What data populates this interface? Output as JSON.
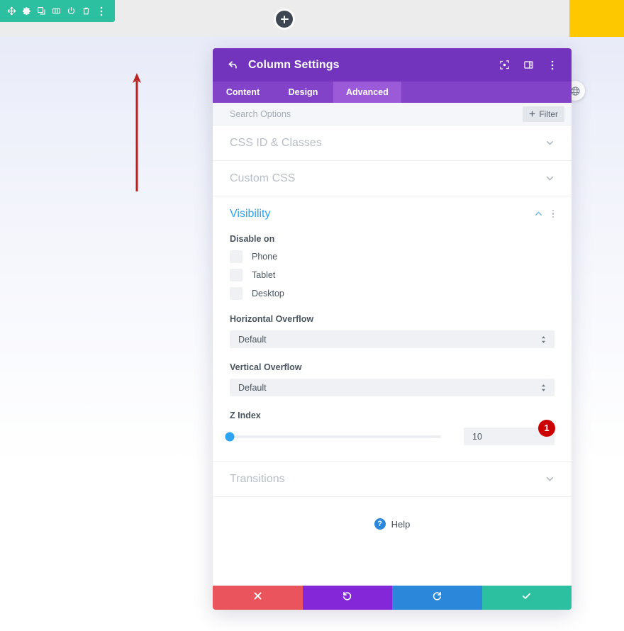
{
  "canvas": {
    "module_toolbar": {
      "buttons": [
        {
          "name": "move-icon",
          "label": "Move"
        },
        {
          "name": "gear-icon",
          "label": "Settings"
        },
        {
          "name": "duplicate-icon",
          "label": "Duplicate"
        },
        {
          "name": "columns-icon",
          "label": "Columns"
        },
        {
          "name": "power-icon",
          "label": "Disable"
        },
        {
          "name": "trash-icon",
          "label": "Delete"
        },
        {
          "name": "kebab-icon",
          "label": "More options"
        }
      ],
      "color": "#2cc0a0"
    },
    "add_button": {
      "name": "add-section-button",
      "label": "+"
    },
    "yellow_block": {
      "color": "#fdc800"
    },
    "globe_chip": {
      "name": "globe-icon"
    },
    "annotation_arrow": {
      "color": "#cc2222",
      "direction": "up"
    }
  },
  "modal": {
    "header": {
      "title": "Column Settings",
      "back_icon": "back-arrow-icon",
      "icons": [
        {
          "name": "focus-target-icon",
          "label": "Focus"
        },
        {
          "name": "layout-panel-icon",
          "label": "Panel layout"
        },
        {
          "name": "kebab-icon",
          "label": "More options"
        }
      ]
    },
    "tabs": [
      {
        "label": "Content",
        "active": false
      },
      {
        "label": "Design",
        "active": false
      },
      {
        "label": "Advanced",
        "active": true
      }
    ],
    "search": {
      "placeholder": "Search Options",
      "filter_label": "Filter",
      "filter_icon": "plus-icon"
    },
    "sections": [
      {
        "title": "CSS ID & Classes",
        "open": false
      },
      {
        "title": "Custom CSS",
        "open": false
      },
      {
        "title": "Visibility",
        "open": true
      },
      {
        "title": "Transitions",
        "open": false
      }
    ],
    "visibility": {
      "disable_on_label": "Disable on",
      "devices": [
        {
          "label": "Phone",
          "checked": false
        },
        {
          "label": "Tablet",
          "checked": false
        },
        {
          "label": "Desktop",
          "checked": false
        }
      ],
      "horizontal_overflow": {
        "label": "Horizontal Overflow",
        "value": "Default"
      },
      "vertical_overflow": {
        "label": "Vertical Overflow",
        "value": "Default"
      },
      "z_index": {
        "label": "Z Index",
        "value": "10",
        "slider_percent": 0,
        "callout": "1",
        "accent_color": "#2ea3f2"
      }
    },
    "help": {
      "label": "Help",
      "icon": "question-mark-icon"
    },
    "footer": [
      {
        "name": "cancel-button",
        "icon": "x-icon",
        "color": "#e9545d"
      },
      {
        "name": "undo-button",
        "icon": "undo-icon",
        "color": "#8327d8"
      },
      {
        "name": "redo-button",
        "icon": "redo-icon",
        "color": "#2b87da"
      },
      {
        "name": "save-button",
        "icon": "check-icon",
        "color": "#2cc0a0"
      }
    ]
  }
}
